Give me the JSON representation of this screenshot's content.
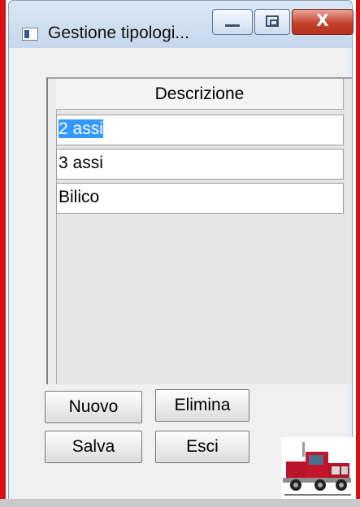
{
  "window": {
    "title": "Gestione tipologi...",
    "close_symbol": "X"
  },
  "grid": {
    "column_header": "Descrizione",
    "rows": [
      "2 assi",
      "3 assi",
      "Bilico"
    ],
    "selected_row": 0
  },
  "buttons": {
    "new": "Nuovo",
    "delete": "Elimina",
    "save": "Salva",
    "exit": "Esci"
  },
  "colors": {
    "frame": "#d80f12",
    "selection": "#3399ff",
    "close_button": "#c5432d"
  },
  "icons": [
    "app-icon",
    "minimize-icon",
    "maximize-icon",
    "close-icon",
    "truck-logo"
  ]
}
